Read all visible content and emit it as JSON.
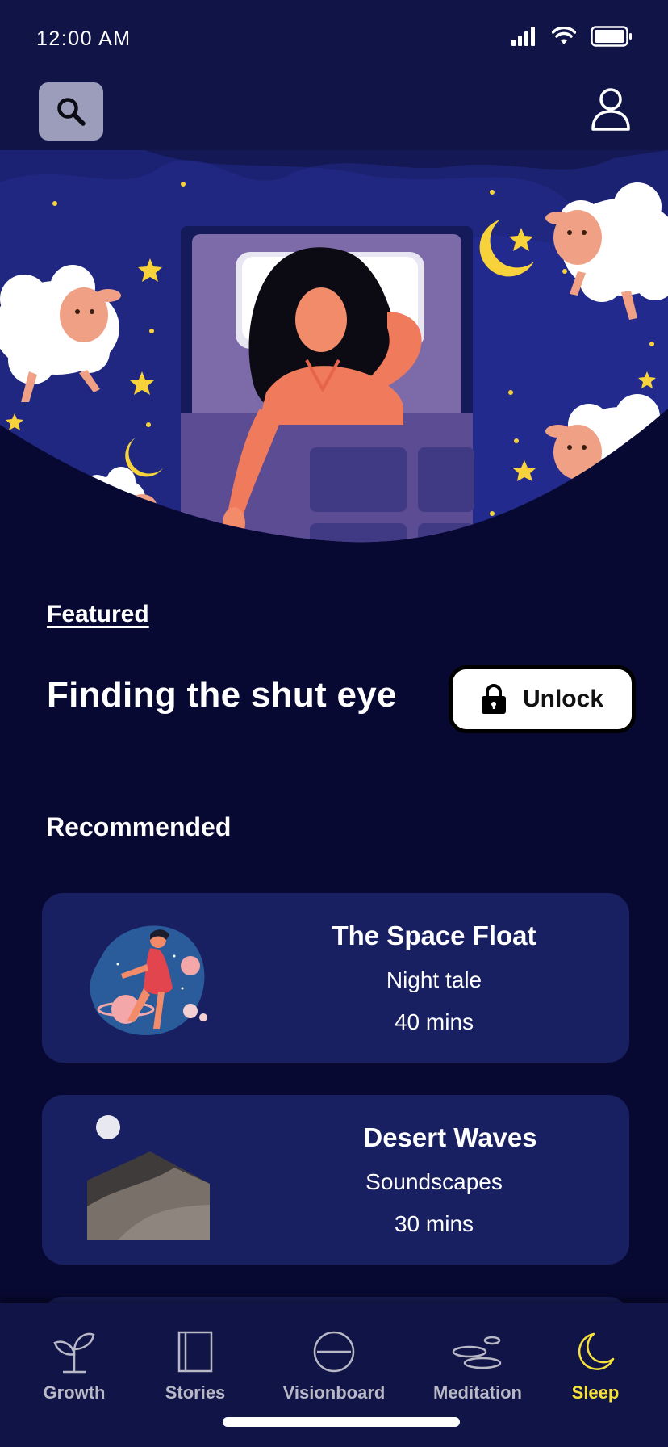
{
  "status_bar": {
    "time": "12:00 AM"
  },
  "header": {
    "search_icon": "search-icon",
    "profile_icon": "user-icon"
  },
  "featured": {
    "label": "Featured",
    "title": "Finding the shut eye",
    "unlock_label": "Unlock",
    "unlock_icon": "lock-icon"
  },
  "recommended": {
    "label": "Recommended",
    "items": [
      {
        "title": "The Space Float",
        "category": "Night tale",
        "duration": "40 mins"
      },
      {
        "title": "Desert Waves",
        "category": "Soundscapes",
        "duration": "30 mins"
      }
    ]
  },
  "nav": {
    "items": [
      {
        "label": "Growth",
        "icon": "sprout-icon"
      },
      {
        "label": "Stories",
        "icon": "book-icon"
      },
      {
        "label": "Visionboard",
        "icon": "minus-circle-icon"
      },
      {
        "label": "Meditation",
        "icon": "stones-icon"
      },
      {
        "label": "Sleep",
        "icon": "moon-icon"
      }
    ],
    "active": "Sleep"
  },
  "colors": {
    "background": "#080933",
    "header": "#111447",
    "card": "#192061",
    "accent": "#f7e23a"
  }
}
